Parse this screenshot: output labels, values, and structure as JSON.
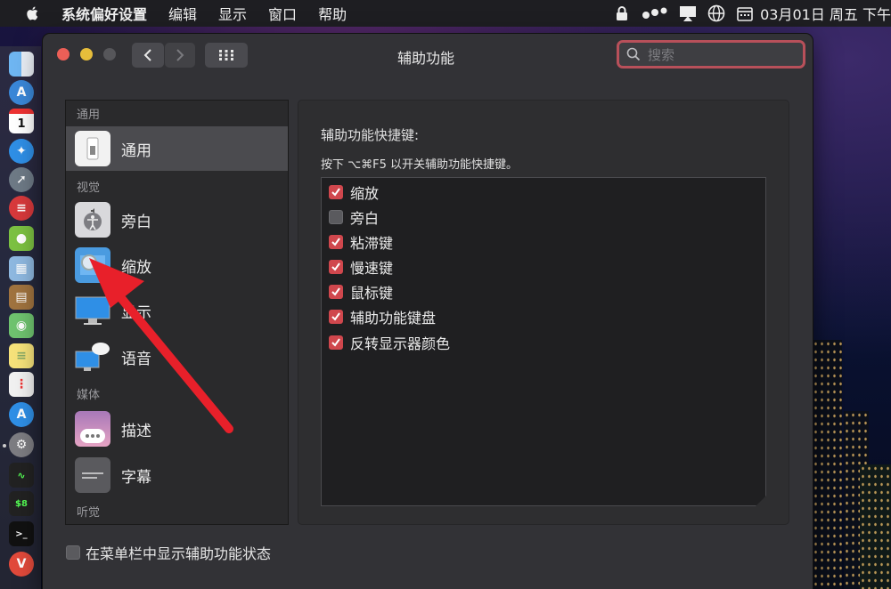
{
  "menubar": {
    "items": [
      "系统偏好设置",
      "编辑",
      "显示",
      "窗口",
      "帮助"
    ],
    "clock": "03月01日 周五 下午"
  },
  "window": {
    "title": "辅助功能",
    "search_placeholder": "搜索"
  },
  "sidebar": {
    "sections": [
      {
        "header": "通用",
        "items": [
          {
            "label": "通用",
            "icon": "general-switch-icon",
            "selected": true
          }
        ]
      },
      {
        "header": "视觉",
        "items": [
          {
            "label": "旁白",
            "icon": "voiceover-icon"
          },
          {
            "label": "缩放",
            "icon": "zoom-icon"
          },
          {
            "label": "显示",
            "icon": "display-icon"
          },
          {
            "label": "语音",
            "icon": "speech-icon"
          }
        ]
      },
      {
        "header": "媒体",
        "items": [
          {
            "label": "描述",
            "icon": "descriptions-icon"
          },
          {
            "label": "字幕",
            "icon": "captions-icon"
          }
        ]
      },
      {
        "header": "听觉",
        "items": []
      }
    ]
  },
  "panel": {
    "title": "辅助功能快捷键:",
    "subtitle": "按下 ⌥⌘F5 以开关辅助功能快捷键。",
    "options": [
      {
        "label": "缩放",
        "checked": true
      },
      {
        "label": "旁白",
        "checked": false
      },
      {
        "label": "粘滞键",
        "checked": true
      },
      {
        "label": "慢速键",
        "checked": true
      },
      {
        "label": "鼠标键",
        "checked": true
      },
      {
        "label": "辅助功能键盘",
        "checked": true
      },
      {
        "label": "反转显示器颜色",
        "checked": true
      }
    ]
  },
  "bottom": {
    "show_in_menubar_label": "在菜单栏中显示辅助功能状态",
    "show_in_menubar_checked": false
  },
  "colors": {
    "accent": "#d0474d",
    "annotation_arrow": "#e8202a"
  }
}
